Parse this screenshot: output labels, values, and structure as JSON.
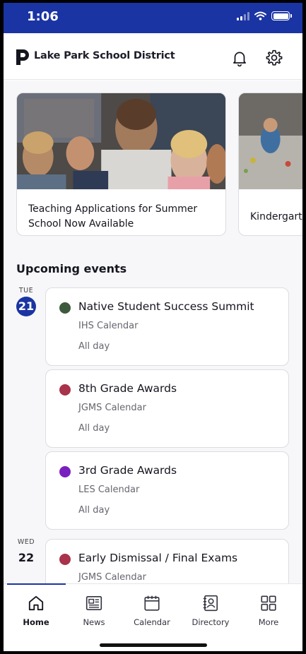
{
  "status_bar": {
    "time": "1:06"
  },
  "header": {
    "district_name": "Lake Park School District"
  },
  "news_cards": [
    {
      "title": "Teaching Applications for Summer School Now Available"
    },
    {
      "title": "Kindergarte"
    }
  ],
  "events_section": {
    "title": "Upcoming events"
  },
  "days": [
    {
      "dow": "TUE",
      "day": "21",
      "events": [
        {
          "name": "Native Student Success Summit",
          "calendar": "IHS Calendar",
          "when": "All day",
          "color": "#3e5a3c"
        },
        {
          "name": "8th Grade Awards",
          "calendar": "JGMS Calendar",
          "when": "All day",
          "color": "#a8334a"
        },
        {
          "name": "3rd Grade Awards",
          "calendar": "LES Calendar",
          "when": "All day",
          "color": "#7a1fbf"
        }
      ]
    },
    {
      "dow": "WED",
      "day": "22",
      "events": [
        {
          "name": "Early Dismissal / Final Exams",
          "calendar": "JGMS Calendar",
          "color": "#a8334a"
        }
      ]
    }
  ],
  "tabs": [
    {
      "label": "Home",
      "icon": "home-icon"
    },
    {
      "label": "News",
      "icon": "news-icon"
    },
    {
      "label": "Calendar",
      "icon": "calendar-icon"
    },
    {
      "label": "Directory",
      "icon": "directory-icon"
    },
    {
      "label": "More",
      "icon": "grid-icon"
    }
  ],
  "colors": {
    "brand": "#1b34a3"
  }
}
